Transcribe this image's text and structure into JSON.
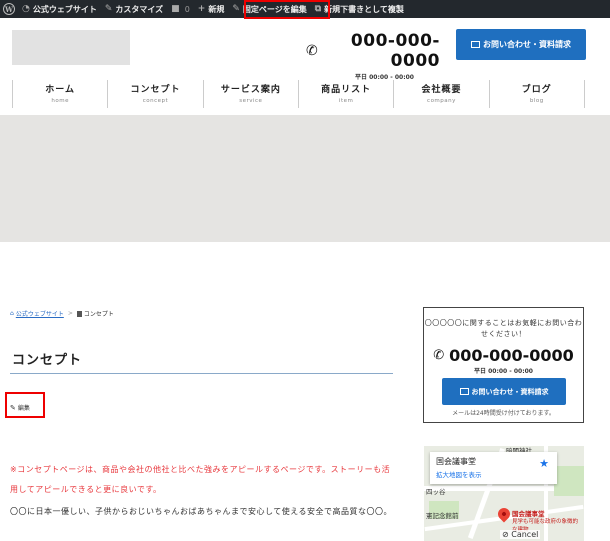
{
  "admin_bar": {
    "logo_icon": "wordpress-icon",
    "items": [
      {
        "icon": "dashboard-icon",
        "label": "公式ウェブサイト"
      },
      {
        "icon": "brush-icon",
        "label": "カスタマイズ"
      },
      {
        "icon": "comment-icon",
        "label": "0"
      },
      {
        "icon": "plus-icon",
        "label": "新規"
      },
      {
        "icon": "pencil-icon",
        "label": "固定ページを編集"
      },
      {
        "icon": "copy-icon",
        "label": "新規下書きとして複製"
      }
    ]
  },
  "header": {
    "phone": "000-000-0000",
    "hours": "平日 00:00 - 00:00",
    "contact_button": "お問い合わせ・資料請求"
  },
  "nav": [
    {
      "jp": "ホーム",
      "en": "home"
    },
    {
      "jp": "コンセプト",
      "en": "concept"
    },
    {
      "jp": "サービス案内",
      "en": "service"
    },
    {
      "jp": "商品リスト",
      "en": "item"
    },
    {
      "jp": "会社概要",
      "en": "company"
    },
    {
      "jp": "ブログ",
      "en": "blog"
    }
  ],
  "breadcrumb": {
    "home": "公式ウェブサイト",
    "separator": ">",
    "current": "コンセプト"
  },
  "main": {
    "title": "コンセプト",
    "edit_label": "編集",
    "paragraph_red": "※コンセプトページは、商品や会社の他社と比べた強みをアピールするページです。ストーリーも活用してアピールできると更に良いです。",
    "paragraph_body": "〇〇に日本一優しい、子供からおじいちゃんおばあちゃんまで安心して使える安全で高品質な〇〇。"
  },
  "sidebar": {
    "intro": "〇〇〇〇〇に関することはお気軽にお問い合わせください！",
    "phone": "000-000-0000",
    "hours": "平日 00:00 - 00:00",
    "contact_button": "お問い合わせ・資料請求",
    "note": "メールは24時間受け付けております。"
  },
  "map": {
    "place": "国会議事堂",
    "link": "拡大地図を表示",
    "label_top": "暗闇神社",
    "label_left": "四ッ谷",
    "label_museum": "憲記念館前",
    "pin_label": "国会議事堂",
    "pin_sub": "見学も可能な政府の象徴的な建物",
    "cancel": "Cancel"
  },
  "colors": {
    "admin_bar": "#23282d",
    "accent": "#1f6fbf",
    "highlight_red": "#e00000",
    "notice_red": "#e8383d"
  }
}
